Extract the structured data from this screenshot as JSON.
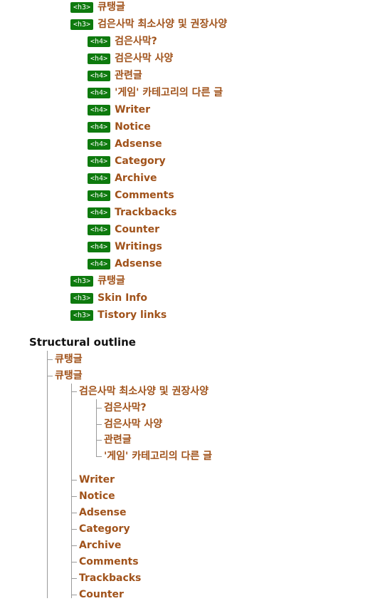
{
  "tags": {
    "h3": "<h3>",
    "h4": "<h4>"
  },
  "heading_list": {
    "item0": "큐탱글",
    "item1": "검은사막 최소사양 및 권장사양",
    "item2": "검은사막?",
    "item3": "검은사막 사양",
    "item4": "관련글",
    "item5": "'게임' 카테고리의 다른 글",
    "item6": "Writer",
    "item7": "Notice",
    "item8": "Adsense",
    "item9": "Category",
    "item10": "Archive",
    "item11": "Comments",
    "item12": "Trackbacks",
    "item13": "Counter",
    "item14": "Writings",
    "item15": "Adsense",
    "item16": "큐탱글",
    "item17": "Skin Info",
    "item18": "Tistory links"
  },
  "outline": {
    "title": "Structural outline",
    "item0": "큐탱글",
    "item1": "큐탱글",
    "item2": "검은사막 최소사양 및 권장사양",
    "item3": "검은사막?",
    "item4": "검은사막 사양",
    "item5": "관련글",
    "item6": "'게임' 카테고리의 다른 글",
    "item7": "Writer",
    "item8": "Notice",
    "item9": "Adsense",
    "item10": "Category",
    "item11": "Archive",
    "item12": "Comments",
    "item13": "Trackbacks",
    "item14": "Counter"
  },
  "colors": {
    "tag_bg": "#0e7a0e",
    "link": "#a0521a",
    "tree_line": "#9a9a9a"
  }
}
